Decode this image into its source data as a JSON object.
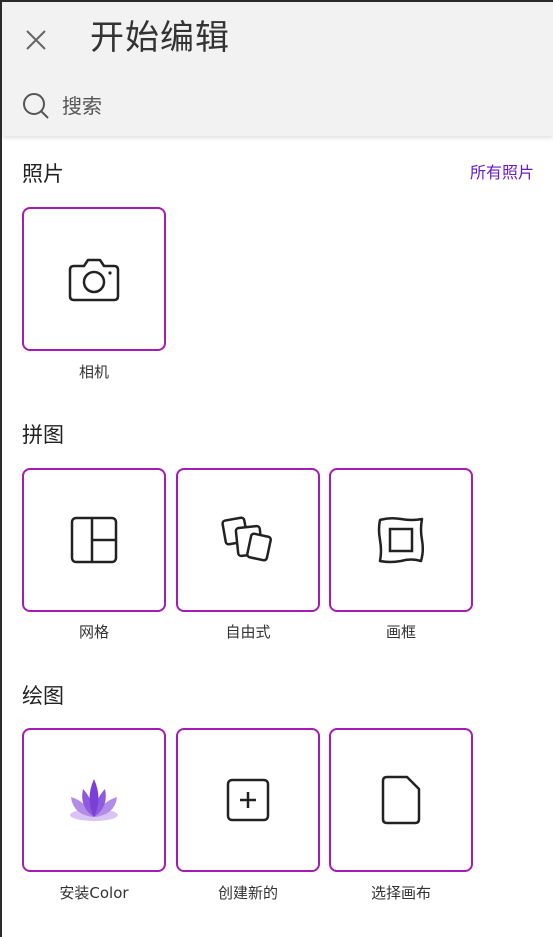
{
  "header": {
    "title": "开始编辑",
    "close_icon": "close-icon",
    "search": {
      "placeholder": "搜索",
      "icon": "search-icon"
    }
  },
  "accent_color": "#a51bb3",
  "link_color": "#6a1bc9",
  "sections": {
    "photos": {
      "title": "照片",
      "see_all_label": "所有照片",
      "items": [
        {
          "label": "相机",
          "icon": "camera-icon"
        }
      ]
    },
    "collage": {
      "title": "拼图",
      "items": [
        {
          "label": "网格",
          "icon": "grid-layout-icon"
        },
        {
          "label": "自由式",
          "icon": "freestyle-icon"
        },
        {
          "label": "画框",
          "icon": "frame-icon"
        }
      ]
    },
    "drawing": {
      "title": "绘图",
      "items": [
        {
          "label": "安装Color",
          "icon": "lotus-icon"
        },
        {
          "label": "创建新的",
          "icon": "plus-square-icon"
        },
        {
          "label": "选择画布",
          "icon": "document-icon"
        }
      ]
    }
  }
}
